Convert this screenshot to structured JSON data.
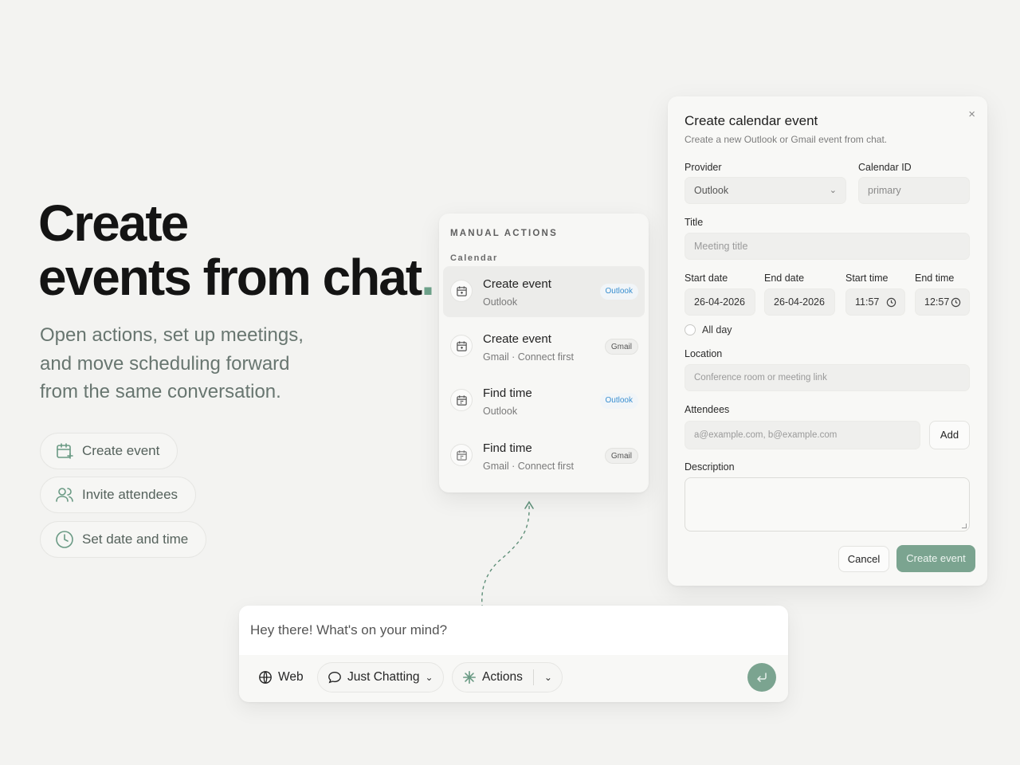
{
  "hero": {
    "title_line1": "Create",
    "title_line2": "events from chat",
    "title_dot": ".",
    "subtitle": "Open actions, set up meetings, and move scheduling forward from the same conversation.",
    "pills": [
      {
        "label": "Create event",
        "icon": "calendar-plus-icon"
      },
      {
        "label": "Invite attendees",
        "icon": "users-icon"
      },
      {
        "label": "Set date and time",
        "icon": "clock-icon"
      }
    ]
  },
  "actions_panel": {
    "heading": "MANUAL ACTIONS",
    "section": "Calendar",
    "items": [
      {
        "title": "Create event",
        "meta": "Outlook",
        "badge": "Outlook",
        "badge_type": "outlook"
      },
      {
        "title": "Create event",
        "meta": "Gmail · Connect first",
        "badge": "Gmail",
        "badge_type": "gmail"
      },
      {
        "title": "Find time",
        "meta": "Outlook",
        "badge": "Outlook",
        "badge_type": "outlook"
      },
      {
        "title": "Find time",
        "meta": "Gmail · Connect first",
        "badge": "Gmail",
        "badge_type": "gmail"
      }
    ]
  },
  "dialog": {
    "title": "Create calendar event",
    "description": "Create a new Outlook or Gmail event from chat.",
    "close": "×",
    "provider_label": "Provider",
    "provider_value": "Outlook",
    "calendar_id_label": "Calendar ID",
    "calendar_id_value": "primary",
    "title_label": "Title",
    "title_placeholder": "Meeting title",
    "start_date_label": "Start date",
    "start_date": "26-04-2026",
    "end_date_label": "End date",
    "end_date": "26-04-2026",
    "start_time_label": "Start time",
    "start_time": "11:57",
    "end_time_label": "End time",
    "end_time": "12:57",
    "all_day_label": "All day",
    "location_label": "Location",
    "location_placeholder": "Conference room or meeting link",
    "attendees_label": "Attendees",
    "attendees_placeholder": "a@example.com, b@example.com",
    "add_label": "Add",
    "description_label": "Description",
    "cancel_label": "Cancel",
    "create_label": "Create event",
    "accent_color": "#7ba490"
  },
  "chat": {
    "placeholder": "Hey there! What's on your mind?",
    "web_label": "Web",
    "mode_label": "Just Chatting",
    "actions_label": "Actions"
  }
}
